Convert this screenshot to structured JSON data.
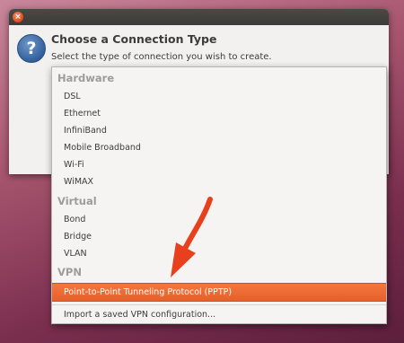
{
  "window": {
    "close_glyph": "×",
    "icon_glyph": "?",
    "title": "Choose a Connection Type",
    "subtitle": "Select the type of connection you wish to create."
  },
  "menu": {
    "sections": [
      {
        "label": "Hardware",
        "items": [
          "DSL",
          "Ethernet",
          "InfiniBand",
          "Mobile Broadband",
          "Wi-Fi",
          "WiMAX"
        ]
      },
      {
        "label": "Virtual",
        "items": [
          "Bond",
          "Bridge",
          "VLAN"
        ]
      },
      {
        "label": "VPN",
        "items": [
          "Point-to-Point Tunneling Protocol (PPTP)"
        ]
      }
    ],
    "selected_item": "Point-to-Point Tunneling Protocol (PPTP)",
    "import_item": "Import a saved VPN configuration..."
  },
  "colors": {
    "accent": "#f07440",
    "arrow": "#e8401c"
  }
}
